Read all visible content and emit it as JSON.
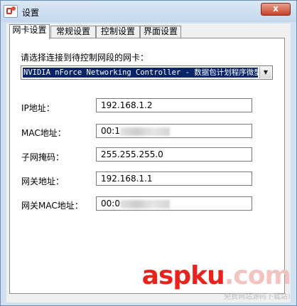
{
  "window": {
    "title": "设置",
    "close_label": "x"
  },
  "tabs": [
    {
      "label": "网卡设置",
      "active": true
    },
    {
      "label": "常规设置",
      "active": false
    },
    {
      "label": "控制设置",
      "active": false
    },
    {
      "label": "界面设置",
      "active": false
    }
  ],
  "nic": {
    "prompt": "请选择连接到待控制网段的网卡：",
    "selected": "NVIDIA nForce Networking Controller - 数据包计划程序微型"
  },
  "fields": {
    "ip": {
      "label": "IP地址：",
      "value": "192.168.1.2"
    },
    "mac": {
      "label": "MAC地址：",
      "value": "00:1"
    },
    "mask": {
      "label": "子网掩码：",
      "value": "255.255.255.0"
    },
    "gateway": {
      "label": "网关地址：",
      "value": "192.168.1.1"
    },
    "gateway_mac": {
      "label": "网关MAC地址：",
      "value": "00:0"
    }
  },
  "watermark": {
    "main_a": "asp",
    "main_b": "ku",
    "main_c": ".com",
    "sub": "免费网站源码下载站!"
  }
}
